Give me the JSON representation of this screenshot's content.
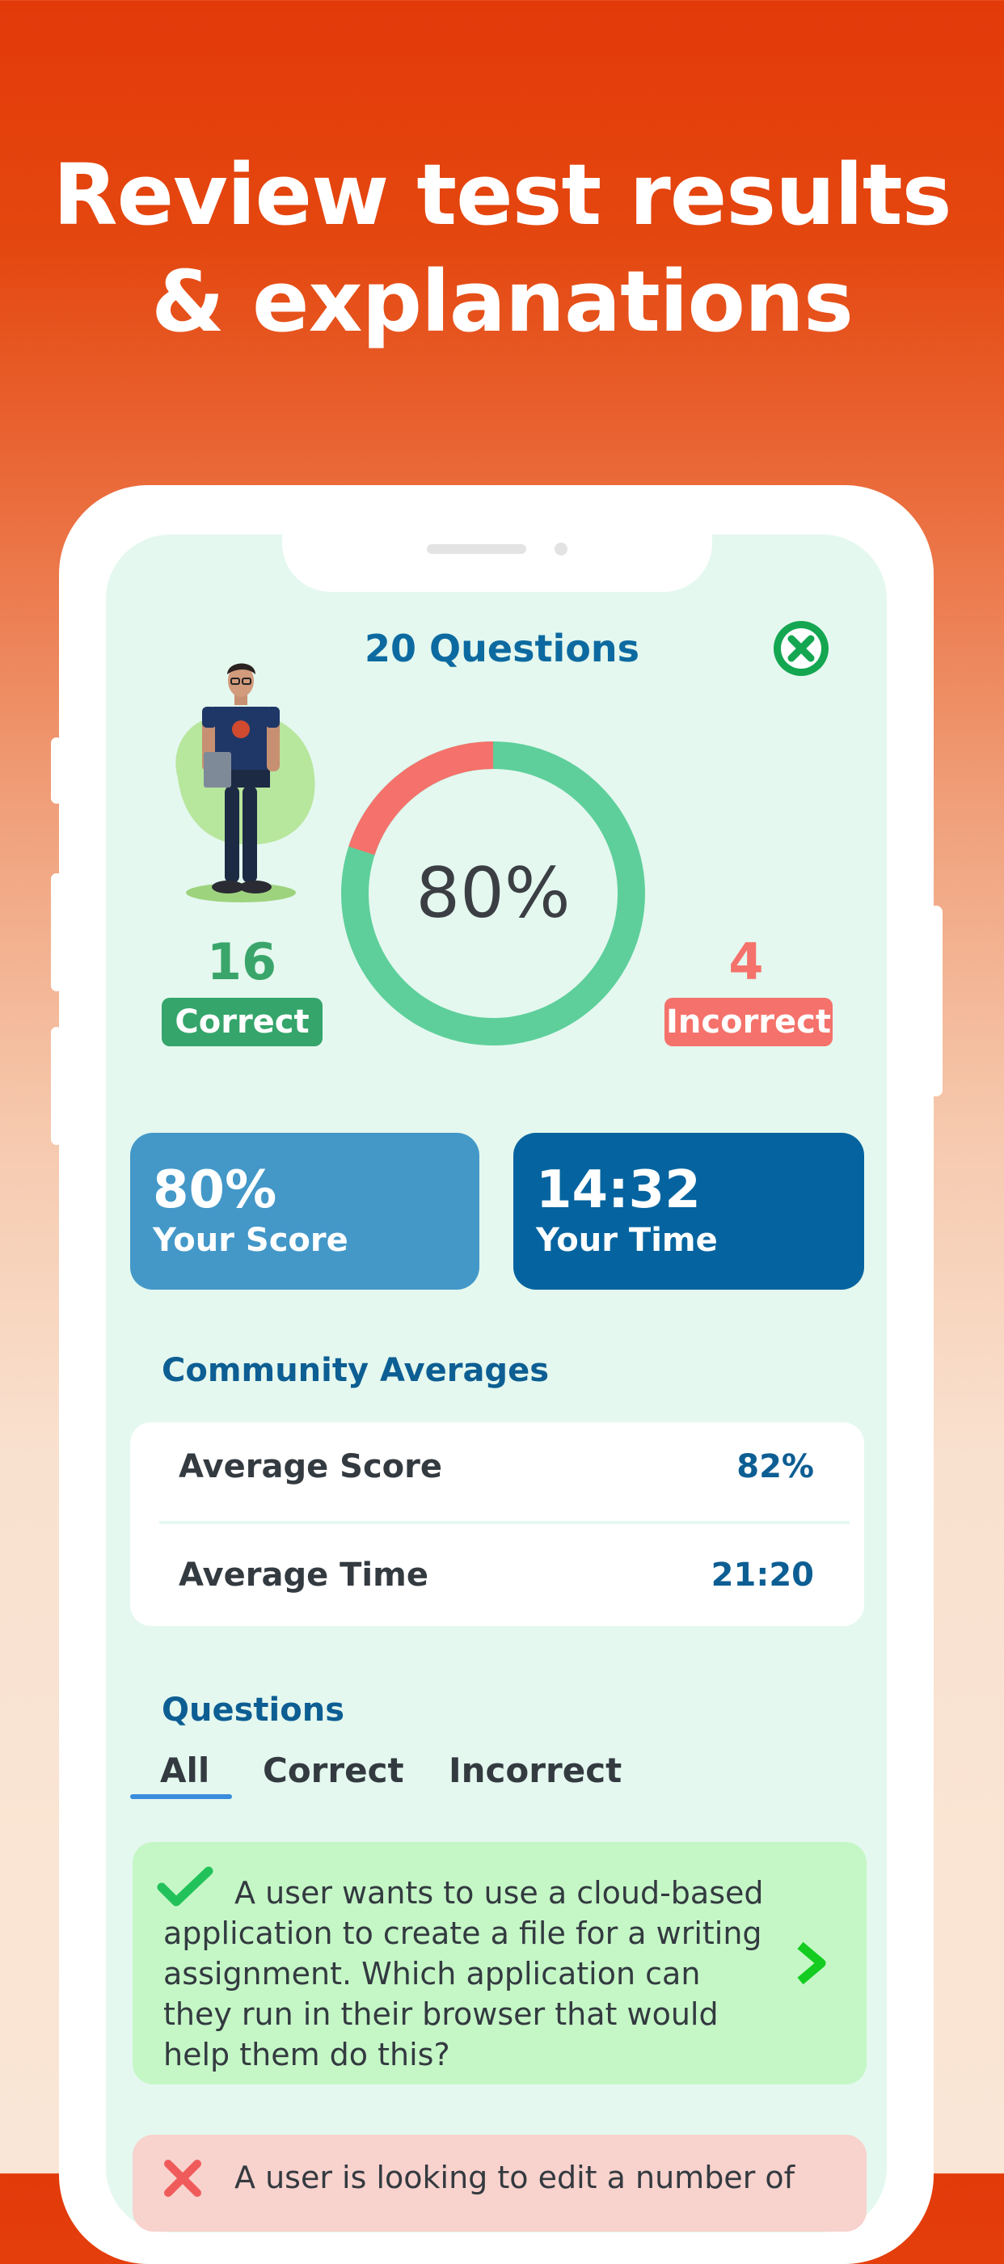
{
  "headline": {
    "line1": "Review test results",
    "line2": "& explanations"
  },
  "results": {
    "title": "20 Questions",
    "percent": "80%",
    "correct_fraction": 0.8,
    "correct_count": "16",
    "correct_label": "Correct",
    "incorrect_count": "4",
    "incorrect_label": "Incorrect"
  },
  "score_card": {
    "value": "80%",
    "label": "Your Score"
  },
  "time_card": {
    "value": "14:32",
    "label": "Your Time"
  },
  "community": {
    "title": "Community Averages",
    "rows": [
      {
        "label": "Average Score",
        "value": "82%"
      },
      {
        "label": "Average Time",
        "value": "21:20"
      }
    ]
  },
  "questions": {
    "title": "Questions",
    "tabs": [
      "All",
      "Correct",
      "Incorrect"
    ],
    "items": [
      {
        "status": "correct",
        "text": "A user wants to use a cloud-based application to create a file for a writing assignment. Which application can they run in their browser that would help them do this?"
      },
      {
        "status": "incorrect",
        "text": "A user is looking to edit a number of"
      }
    ]
  },
  "colors": {
    "brand_orange": "#e33a0a",
    "correct_green": "#5ecf9b",
    "incorrect_red": "#f4726b",
    "primary_blue": "#0d6aa0"
  }
}
